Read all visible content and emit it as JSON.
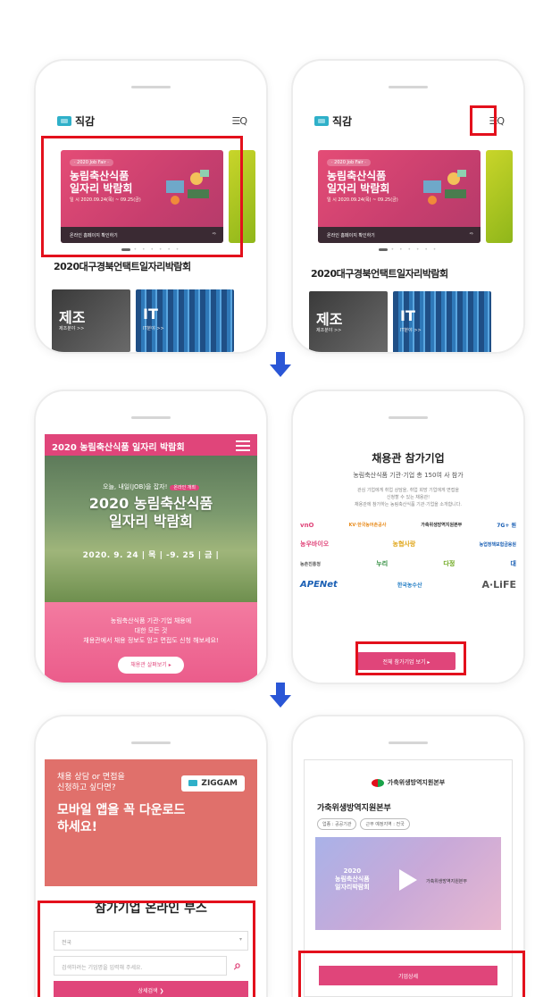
{
  "row1": {
    "brand": "직감",
    "menu_search": "☰Q",
    "banner": {
      "tag": "· 2020 Job Fair ·",
      "title": "농림축산식품\n일자리 박람회",
      "date": "일  시   2020.09.24(목) ~ 09.25(금)",
      "footer": "온라인 홈페이지 확인하기",
      "footer_arrow": "⇨"
    },
    "fair_title": "2020대구경북언택트일자리박람회",
    "categories": [
      {
        "label": "제조",
        "sub": "제조분야  >>"
      },
      {
        "label": "IT",
        "sub": "IT분야  >>"
      }
    ]
  },
  "row2": {
    "expo": {
      "topbar": "2020 농림축산식품 일자리 박람회",
      "small": "오늘, 내일(JOB)을 잡자!",
      "badge": "온라인 개최",
      "title": "2020 농림축산식품\n일자리 박람회",
      "date": "2020. 9. 24 | 목 | -9. 25 | 금 |",
      "pink_text": "농림축산식품 기관·기업 채용에\n대한 모든 것\n채용관에서 채용 정보도 얻고 면접도 신청 해보세요!",
      "pink_button": "채용관 살펴보기  ▸"
    },
    "companies": {
      "title": "채용관 참가기업",
      "sub": "농림축산식품 기관·기업 총 150여 사 참가",
      "desc": "관심 기업에게 취업 상담을, 취업 희망 기업에게 면접을\n신청할 수 있는 채용관!\n채용관에 참가하는 농림축산식품 기관·기업을 소개합니다.",
      "logos": [
        [
          "vnO",
          "KV·한국농어촌공사",
          "가축위생방역지원본부",
          "7G+ 원"
        ],
        [
          "농우바이오",
          "농협사랑",
          "농업정책보험금융원",
          ""
        ],
        [
          "농촌진흥청",
          "누리",
          "다정",
          "대"
        ],
        [
          "APENet",
          "한국농수산",
          "A·LiFE",
          ""
        ]
      ],
      "button": "전체 참가기업 보기  ▸"
    }
  },
  "row3": {
    "promo": {
      "question": "채용 상담 or 면접을\n신청하고 싶다면?",
      "headline": "모바일 앱을 꼭 다운로드\n하세요!",
      "badge": "ZIGGAM"
    },
    "booth_title": "참가기업 온라인 부스",
    "select_value": "전국",
    "search_placeholder": "검색하려는 기업명을 입력해 주세요.",
    "advanced_button": "상세검색 ❯",
    "org": {
      "logo_text": "가축위생방역지원본부",
      "name": "가축위생방역지원본부",
      "chips": [
        "업종 : 공공기관",
        "근무 예정지역 : 전국"
      ],
      "video_title": "2020\n농림축산식품\n일자리박람회",
      "video_org": "가축위생방역지원본부",
      "detail_button": "기업상세"
    }
  },
  "colors": {
    "pink": "#e0457a",
    "highlight_red": "#e3101c",
    "arrow_blue": "#2a56d6"
  }
}
